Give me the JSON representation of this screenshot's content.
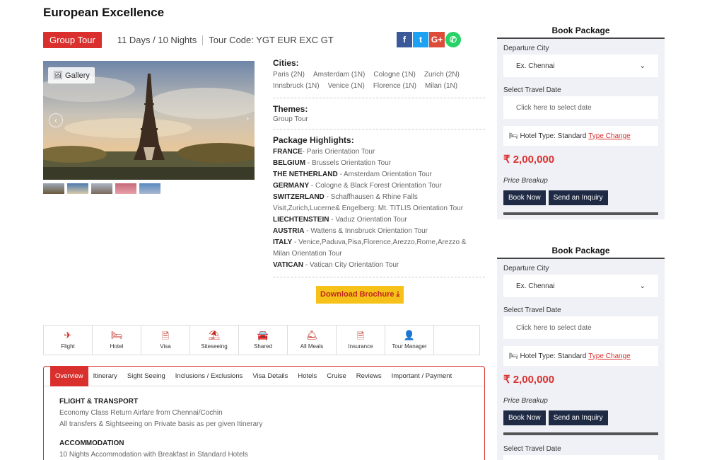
{
  "title": "European Excellence",
  "badge": "Group Tour",
  "duration": "11 Days / 10 Nights",
  "tour_code": "Tour Code: YGT EUR EXC GT",
  "gallery_label": "Gallery",
  "cities_heading": "Cities:",
  "cities": [
    "Paris (2N)",
    "Amsterdam (1N)",
    "Cologne (1N)",
    "Zurich (2N)",
    "Innsbruck (1N)",
    "Venice (1N)",
    "Florence (1N)",
    "Milan (1N)"
  ],
  "themes_heading": "Themes:",
  "theme": "Group Tour",
  "highlights_heading": "Package Highlights:",
  "highlights": [
    {
      "country": "FRANCE",
      "detail": "- Paris Orientation Tour"
    },
    {
      "country": "BELGIUM",
      "detail": " - Brussels Orientation Tour"
    },
    {
      "country": "THE NETHERLAND",
      "detail": " - Amsterdam Orientation Tour"
    },
    {
      "country": "GERMANY",
      "detail": " - Cologne & Black Forest Orientation Tour"
    },
    {
      "country": "SWITZERLAND",
      "detail": " - Schaffhausen & Rhine Falls Visit,Zurich,Lucerne& Engelberg: Mt. TITLIS Orientation Tour"
    },
    {
      "country": "LIECHTENSTEIN",
      "detail": " - Vaduz Orientation Tour"
    },
    {
      "country": "AUSTRIA",
      "detail": " - Wattens & Innsbruck Orientation Tour"
    },
    {
      "country": "ITALY",
      "detail": " - Venice,Paduva,Pisa,Florence,Arezzo,Rome,Arezzo & Milan Orientation Tour"
    },
    {
      "country": "VATICAN",
      "detail": "  - Vatican City Orientation Tour"
    }
  ],
  "brochure_label": "Download Brochure ⤓",
  "amenities": [
    {
      "label": "Flight",
      "icon": "✈"
    },
    {
      "label": "Hotel",
      "icon": "🛏"
    },
    {
      "label": "Visa",
      "icon": "🗎"
    },
    {
      "label": "Siteseeing",
      "icon": "⛱"
    },
    {
      "label": "Shared",
      "icon": "🚘"
    },
    {
      "label": "All Meals",
      "icon": "🛎"
    },
    {
      "label": "Insurance",
      "icon": "🗎"
    },
    {
      "label": "Tour Manager",
      "icon": "👤"
    }
  ],
  "tabs": [
    "Overview",
    "Itinerary",
    "Sight Seeing",
    "Inclusions / Exclusions",
    "Visa Details",
    "Hotels",
    "Cruise",
    "Reviews",
    "Important / Payment"
  ],
  "overview": {
    "flight_heading": "FLIGHT & TRANSPORT",
    "flight_line1": "Economy Class Return Airfare from Chennai/Cochin",
    "flight_line2": "All transfers & Sightseeing on Private basis as per given Itinerary",
    "accom_heading": "ACCOMMODATION",
    "accom_line1": "10 Nights Accommodation with Breakfast in Standard Hotels"
  },
  "book": {
    "heading": "Book Package",
    "departure_label": "Departure City",
    "departure_value": "Ex. Chennai",
    "date_label": "Select Travel Date",
    "date_placeholder": "Click here to select date",
    "hotel_type": "Hotel Type: Standard",
    "type_change": "Type Change",
    "price": "₹ 2,00,000",
    "price_breakup": "Price Breakup",
    "book_now": "Book Now",
    "inquiry": "Send an Inquiry"
  }
}
